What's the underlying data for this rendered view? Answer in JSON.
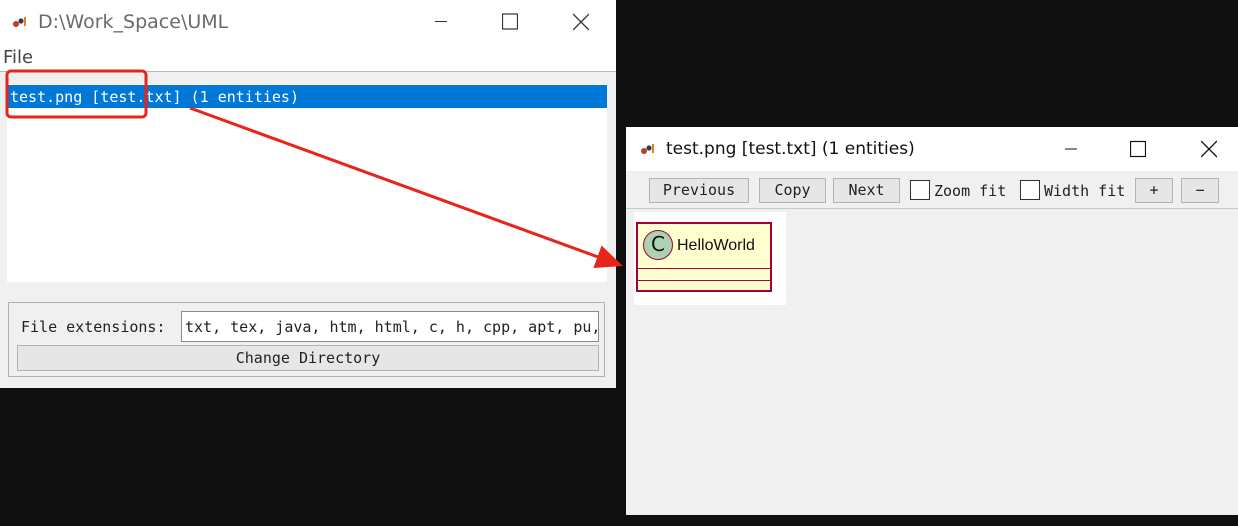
{
  "left_window": {
    "title": "D:\\Work_Space\\UML",
    "menu": {
      "file_label": "File"
    },
    "file_list": {
      "items": [
        {
          "label": "test.png [test.txt] (1 entities)",
          "selected": true
        }
      ]
    },
    "file_extensions": {
      "label": "File extensions:",
      "value": "txt, tex, java, htm, html, c, h, cpp, apt, pu,"
    },
    "change_directory_label": "Change Directory"
  },
  "right_window": {
    "title": "test.png [test.txt] (1 entities)",
    "toolbar": {
      "previous_label": "Previous",
      "copy_label": "Copy",
      "next_label": "Next",
      "zoom_fit_label": "Zoom fit",
      "zoom_fit_checked": false,
      "width_fit_label": "Width fit",
      "width_fit_checked": false,
      "zoom_in_label": "+",
      "zoom_out_label": "−"
    },
    "diagram": {
      "class_name": "HelloWorld",
      "stereotype_letter": "C"
    }
  },
  "colors": {
    "selection": "#0078d7",
    "annotation": "#e8251b",
    "class_fill": "#fefece",
    "class_border": "#a80036",
    "circle_fill": "#add1b2"
  }
}
